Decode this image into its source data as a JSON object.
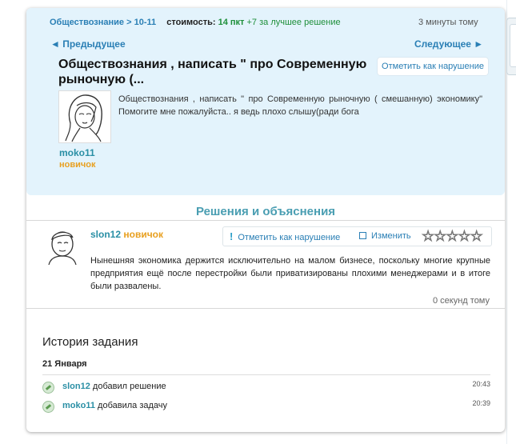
{
  "breadcrumb": {
    "subject": "Обществознание",
    "separator": " > ",
    "grade": "10-11",
    "cost_label": "стоимость:",
    "points": "14 пкт",
    "bonus": "+7 за лучшее решение"
  },
  "question": {
    "time_ago": "3 минуты тому",
    "prev_label": "◄ Предыдущее",
    "next_label": "Следующее ►",
    "title": "Обществознания , написать \" про Современную рыночную (...",
    "report_label": "Отметить как нарушение",
    "text": "Обществознания , написать \" про Современную рыночную ( смешанную) экономику\" Помогите мне пожалуйста.. я ведь плохо слышу(ради бога",
    "user": "moko11",
    "rank": "новичок"
  },
  "answers": {
    "heading": "Решения и объяснения",
    "items": [
      {
        "user": "slon12",
        "rank": "новичок",
        "report_label": "Отметить как нарушение",
        "edit_label": "Изменить",
        "rating": 0,
        "text": "Нынешняя экономика держится исключительно на малом бизнесе, поскольку многие крупные предприятия ещё после перестройки были приватизированы плохими менеджерами и в итоге были развалены.",
        "time": "0 секунд тому"
      }
    ]
  },
  "history": {
    "title": "История задания",
    "date": "21 Января",
    "rows": [
      {
        "user": "slon12",
        "action": "добавил решение",
        "time": "20:43",
        "icon": "pencil-icon"
      },
      {
        "user": "moko11",
        "action": "добавила задачу",
        "time": "20:39",
        "icon": "pencil-icon"
      }
    ]
  },
  "colors": {
    "panel_bg": "#e3f3fc",
    "link": "#2a7fb5",
    "username": "#2a8fa5",
    "rank": "#e8a020",
    "points": "#1e8f3a"
  }
}
